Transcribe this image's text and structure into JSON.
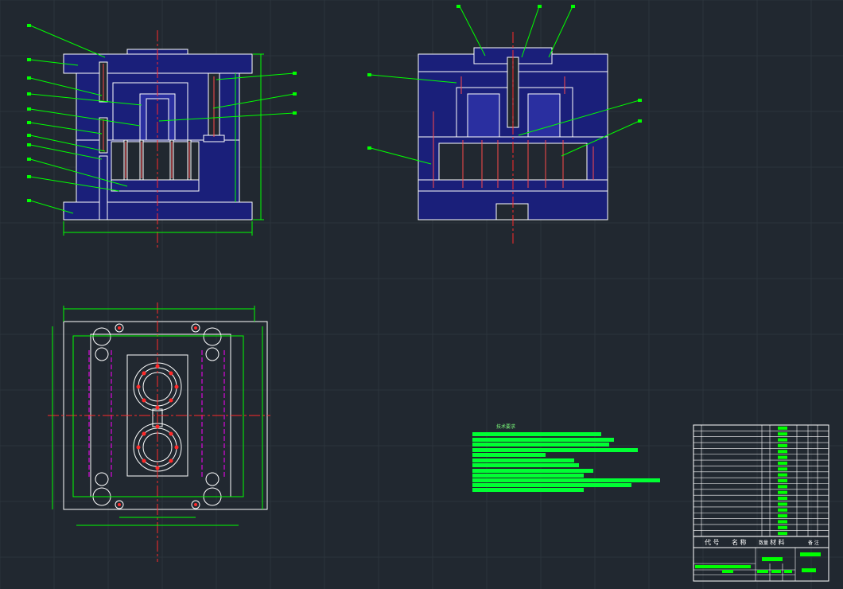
{
  "drawing": {
    "tech_requirements_title": "技术要求",
    "bom_headers": {
      "code": "代 号",
      "name": "名 称",
      "qty": "数量",
      "material": "材 料",
      "note": "备 注"
    }
  },
  "colors": {
    "background": "#212830",
    "grid": "#2c343c",
    "plate_fill": "#1a1f7a",
    "outline": "#ffffff",
    "dimension": "#00ff00",
    "centerline": "#ff2a2a",
    "hidden": "#ff00ff",
    "text_block": "#00ff33"
  },
  "icons": {
    "screw": "hex-screw-icon",
    "guide_pin": "guide-pin-icon",
    "cavity": "cavity-icon"
  }
}
